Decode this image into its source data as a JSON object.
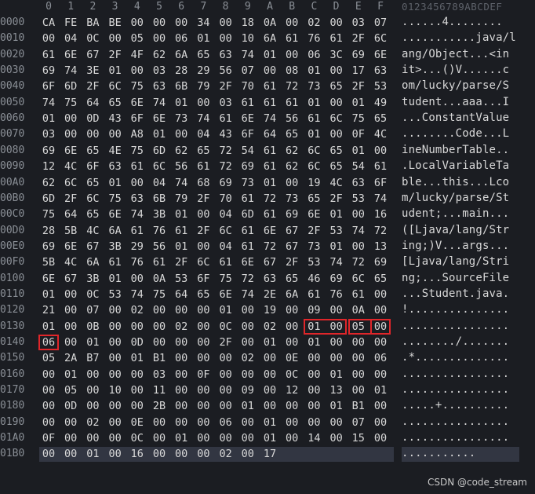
{
  "column_headers": [
    "0",
    "1",
    "2",
    "3",
    "4",
    "5",
    "6",
    "7",
    "8",
    "9",
    "A",
    "B",
    "C",
    "D",
    "E",
    "F"
  ],
  "ascii_header": "0123456789ABCDEF",
  "rows": [
    {
      "offset": "0000",
      "bytes": [
        "CA",
        "FE",
        "BA",
        "BE",
        "00",
        "00",
        "00",
        "34",
        "00",
        "18",
        "0A",
        "00",
        "02",
        "00",
        "03",
        "07"
      ],
      "ascii": "......4........"
    },
    {
      "offset": "0010",
      "bytes": [
        "00",
        "04",
        "0C",
        "00",
        "05",
        "00",
        "06",
        "01",
        "00",
        "10",
        "6A",
        "61",
        "76",
        "61",
        "2F",
        "6C"
      ],
      "ascii": "...........java/l"
    },
    {
      "offset": "0020",
      "bytes": [
        "61",
        "6E",
        "67",
        "2F",
        "4F",
        "62",
        "6A",
        "65",
        "63",
        "74",
        "01",
        "00",
        "06",
        "3C",
        "69",
        "6E"
      ],
      "ascii": "ang/Object...<in"
    },
    {
      "offset": "0030",
      "bytes": [
        "69",
        "74",
        "3E",
        "01",
        "00",
        "03",
        "28",
        "29",
        "56",
        "07",
        "00",
        "08",
        "01",
        "00",
        "17",
        "63"
      ],
      "ascii": "it>...()V......c"
    },
    {
      "offset": "0040",
      "bytes": [
        "6F",
        "6D",
        "2F",
        "6C",
        "75",
        "63",
        "6B",
        "79",
        "2F",
        "70",
        "61",
        "72",
        "73",
        "65",
        "2F",
        "53"
      ],
      "ascii": "om/lucky/parse/S"
    },
    {
      "offset": "0050",
      "bytes": [
        "74",
        "75",
        "64",
        "65",
        "6E",
        "74",
        "01",
        "00",
        "03",
        "61",
        "61",
        "61",
        "01",
        "00",
        "01",
        "49"
      ],
      "ascii": "tudent...aaa...I"
    },
    {
      "offset": "0060",
      "bytes": [
        "01",
        "00",
        "0D",
        "43",
        "6F",
        "6E",
        "73",
        "74",
        "61",
        "6E",
        "74",
        "56",
        "61",
        "6C",
        "75",
        "65"
      ],
      "ascii": "...ConstantValue"
    },
    {
      "offset": "0070",
      "bytes": [
        "03",
        "00",
        "00",
        "00",
        "A8",
        "01",
        "00",
        "04",
        "43",
        "6F",
        "64",
        "65",
        "01",
        "00",
        "0F",
        "4C"
      ],
      "ascii": "........Code...L"
    },
    {
      "offset": "0080",
      "bytes": [
        "69",
        "6E",
        "65",
        "4E",
        "75",
        "6D",
        "62",
        "65",
        "72",
        "54",
        "61",
        "62",
        "6C",
        "65",
        "01",
        "00"
      ],
      "ascii": "ineNumberTable.."
    },
    {
      "offset": "0090",
      "bytes": [
        "12",
        "4C",
        "6F",
        "63",
        "61",
        "6C",
        "56",
        "61",
        "72",
        "69",
        "61",
        "62",
        "6C",
        "65",
        "54",
        "61"
      ],
      "ascii": ".LocalVariableTa"
    },
    {
      "offset": "00A0",
      "bytes": [
        "62",
        "6C",
        "65",
        "01",
        "00",
        "04",
        "74",
        "68",
        "69",
        "73",
        "01",
        "00",
        "19",
        "4C",
        "63",
        "6F"
      ],
      "ascii": "ble...this...Lco"
    },
    {
      "offset": "00B0",
      "bytes": [
        "6D",
        "2F",
        "6C",
        "75",
        "63",
        "6B",
        "79",
        "2F",
        "70",
        "61",
        "72",
        "73",
        "65",
        "2F",
        "53",
        "74"
      ],
      "ascii": "m/lucky/parse/St"
    },
    {
      "offset": "00C0",
      "bytes": [
        "75",
        "64",
        "65",
        "6E",
        "74",
        "3B",
        "01",
        "00",
        "04",
        "6D",
        "61",
        "69",
        "6E",
        "01",
        "00",
        "16"
      ],
      "ascii": "udent;...main..."
    },
    {
      "offset": "00D0",
      "bytes": [
        "28",
        "5B",
        "4C",
        "6A",
        "61",
        "76",
        "61",
        "2F",
        "6C",
        "61",
        "6E",
        "67",
        "2F",
        "53",
        "74",
        "72"
      ],
      "ascii": "([Ljava/lang/Str"
    },
    {
      "offset": "00E0",
      "bytes": [
        "69",
        "6E",
        "67",
        "3B",
        "29",
        "56",
        "01",
        "00",
        "04",
        "61",
        "72",
        "67",
        "73",
        "01",
        "00",
        "13"
      ],
      "ascii": "ing;)V...args..."
    },
    {
      "offset": "00F0",
      "bytes": [
        "5B",
        "4C",
        "6A",
        "61",
        "76",
        "61",
        "2F",
        "6C",
        "61",
        "6E",
        "67",
        "2F",
        "53",
        "74",
        "72",
        "69"
      ],
      "ascii": "[Ljava/lang/Stri"
    },
    {
      "offset": "0100",
      "bytes": [
        "6E",
        "67",
        "3B",
        "01",
        "00",
        "0A",
        "53",
        "6F",
        "75",
        "72",
        "63",
        "65",
        "46",
        "69",
        "6C",
        "65"
      ],
      "ascii": "ng;...SourceFile"
    },
    {
      "offset": "0110",
      "bytes": [
        "01",
        "00",
        "0C",
        "53",
        "74",
        "75",
        "64",
        "65",
        "6E",
        "74",
        "2E",
        "6A",
        "61",
        "76",
        "61",
        "00"
      ],
      "ascii": "...Student.java."
    },
    {
      "offset": "0120",
      "bytes": [
        "21",
        "00",
        "07",
        "00",
        "02",
        "00",
        "00",
        "00",
        "01",
        "00",
        "19",
        "00",
        "09",
        "00",
        "0A",
        "00"
      ],
      "ascii": "!..............."
    },
    {
      "offset": "0130",
      "bytes": [
        "01",
        "00",
        "0B",
        "00",
        "00",
        "00",
        "02",
        "00",
        "0C",
        "00",
        "02",
        "00",
        "01",
        "00",
        "05",
        "00"
      ],
      "ascii": "................"
    },
    {
      "offset": "0140",
      "bytes": [
        "06",
        "00",
        "01",
        "00",
        "0D",
        "00",
        "00",
        "00",
        "2F",
        "00",
        "01",
        "00",
        "01",
        "00",
        "00",
        "00"
      ],
      "ascii": "......../......."
    },
    {
      "offset": "0150",
      "bytes": [
        "05",
        "2A",
        "B7",
        "00",
        "01",
        "B1",
        "00",
        "00",
        "00",
        "02",
        "00",
        "0E",
        "00",
        "00",
        "00",
        "06"
      ],
      "ascii": ".*.............."
    },
    {
      "offset": "0160",
      "bytes": [
        "00",
        "01",
        "00",
        "00",
        "00",
        "03",
        "00",
        "0F",
        "00",
        "00",
        "00",
        "0C",
        "00",
        "01",
        "00",
        "00"
      ],
      "ascii": "................"
    },
    {
      "offset": "0170",
      "bytes": [
        "00",
        "05",
        "00",
        "10",
        "00",
        "11",
        "00",
        "00",
        "00",
        "09",
        "00",
        "12",
        "00",
        "13",
        "00",
        "01"
      ],
      "ascii": "................"
    },
    {
      "offset": "0180",
      "bytes": [
        "00",
        "0D",
        "00",
        "00",
        "00",
        "2B",
        "00",
        "00",
        "00",
        "01",
        "00",
        "00",
        "00",
        "01",
        "B1",
        "00"
      ],
      "ascii": ".....+.........."
    },
    {
      "offset": "0190",
      "bytes": [
        "00",
        "00",
        "02",
        "00",
        "0E",
        "00",
        "00",
        "00",
        "06",
        "00",
        "01",
        "00",
        "00",
        "00",
        "07",
        "00"
      ],
      "ascii": "................"
    },
    {
      "offset": "01A0",
      "bytes": [
        "0F",
        "00",
        "00",
        "00",
        "0C",
        "00",
        "01",
        "00",
        "00",
        "00",
        "01",
        "00",
        "14",
        "00",
        "15",
        "00"
      ],
      "ascii": "................"
    },
    {
      "offset": "01B0",
      "bytes": [
        "00",
        "00",
        "01",
        "00",
        "16",
        "00",
        "00",
        "00",
        "02",
        "00",
        "17"
      ],
      "ascii": "..........."
    }
  ],
  "highlights": [
    {
      "row": 19,
      "start": 12,
      "end": 13
    },
    {
      "row": 19,
      "start": 14,
      "end": 15
    },
    {
      "row": 19,
      "start": 15,
      "end": 15
    },
    {
      "row": 20,
      "start": 0,
      "end": 0
    }
  ],
  "watermark": "CSDN @code_stream",
  "colors": {
    "background": "#1b1d22",
    "highlight": "#e0262a",
    "selected_row": "#323642"
  }
}
